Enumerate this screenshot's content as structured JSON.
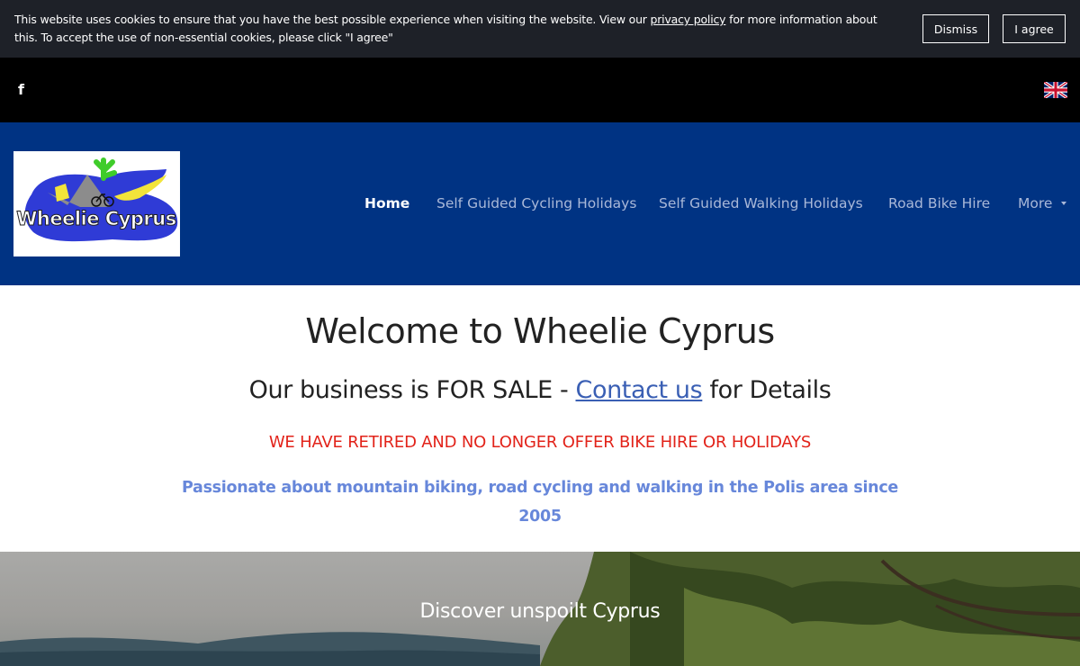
{
  "cookie_bar": {
    "text_before": "This website uses cookies to ensure that you have the best possible experience when visiting the website. View our ",
    "link_text": "privacy policy",
    "text_after": " for more information about this. To accept the use of non-essential cookies, please click \"I agree\"",
    "dismiss_label": "Dismiss",
    "agree_label": "I agree"
  },
  "top_bar": {
    "social_icon": "facebook-icon",
    "facebook_glyph": "f",
    "language_icon": "uk-flag-icon"
  },
  "logo": {
    "text": "Wheelie Cyprus"
  },
  "nav": {
    "items": [
      {
        "label": "Home"
      },
      {
        "label": "Self Guided Cycling Holidays"
      },
      {
        "label": "Self Guided Walking Holidays"
      },
      {
        "label": "Road Bike Hire"
      },
      {
        "label": "More"
      }
    ]
  },
  "main": {
    "title": "Welcome to Wheelie Cyprus",
    "sale_before": "Our business is FOR SALE - ",
    "sale_link": "Contact us",
    "sale_after": " for Details",
    "retired": "WE HAVE RETIRED AND NO LONGER OFFER BIKE HIRE OR HOLIDAYS",
    "passion": "Passionate about mountain biking, road cycling and walking in the Polis area since 2005"
  },
  "hero": {
    "title": "Discover unspoilt Cyprus"
  },
  "colors": {
    "cookie_bg": "#1e2128",
    "header_bg": "#003383",
    "nav_inactive": "#a9b8d8",
    "retired_red": "#e2231a",
    "passion_blue": "#6787da",
    "link_blue": "#3a5fb4"
  }
}
